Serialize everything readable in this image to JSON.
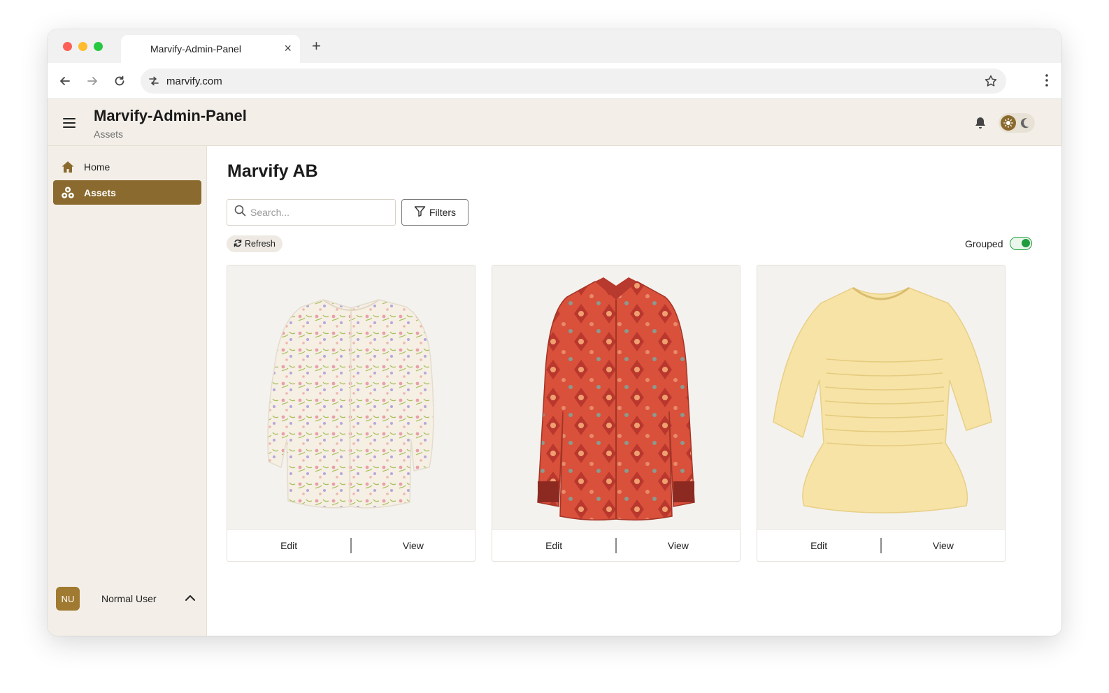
{
  "browser": {
    "tab_title": "Marvify-Admin-Panel",
    "tab_close": "×",
    "new_tab": "+",
    "url": "marvify.com"
  },
  "header": {
    "title": "Marvify-Admin-Panel",
    "subtitle": "Assets"
  },
  "sidebar": {
    "items": [
      {
        "label": "Home",
        "icon": "home-icon"
      },
      {
        "label": "Assets",
        "icon": "assets-icon",
        "active": true
      }
    ],
    "user": {
      "initials": "NU",
      "name": "Normal User"
    }
  },
  "main": {
    "title": "Marvify AB",
    "search_placeholder": "Search...",
    "filters_label": "Filters",
    "refresh_label": "Refresh",
    "grouped_label": "Grouped",
    "grouped_on": true,
    "cards": [
      {
        "garment": "floral-blouse",
        "edit": "Edit",
        "view": "View"
      },
      {
        "garment": "red-paisley-shirt",
        "edit": "Edit",
        "view": "View"
      },
      {
        "garment": "yellow-smocked-top",
        "edit": "Edit",
        "view": "View"
      }
    ]
  },
  "colors": {
    "accent": "#8a6a2e",
    "header_bg": "#f3efe8",
    "toggle_on": "#1f9d3c"
  }
}
